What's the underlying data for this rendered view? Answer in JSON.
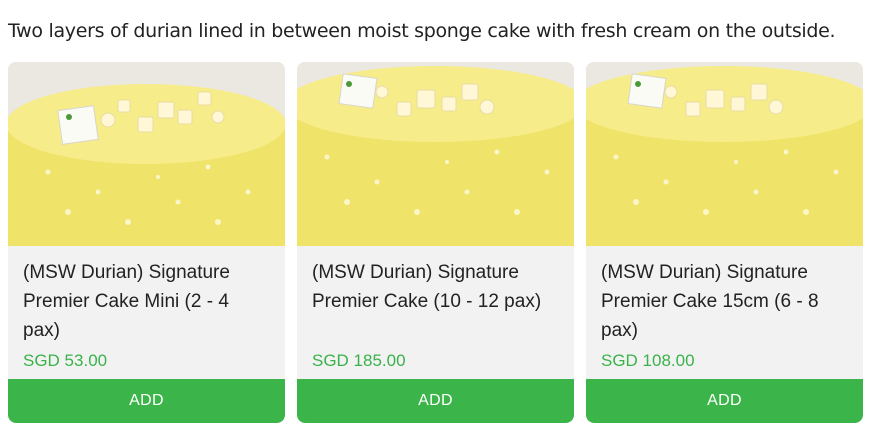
{
  "description": "Two layers of durian lined in between moist sponge cake with fresh cream on the outside.",
  "products": [
    {
      "title": "(MSW Durian) Signature Premier Cake Mini (2 - 4 pax)",
      "price": "SGD 53.00",
      "add_label": "ADD",
      "image_tag_text": "Durian Empire"
    },
    {
      "title": "(MSW Durian) Signature Premier Cake (10 - 12 pax)",
      "price": "SGD 185.00",
      "add_label": "ADD",
      "image_tag_text": "Durian Empire"
    },
    {
      "title": "(MSW Durian) Signature Premier Cake 15cm (6 - 8 pax)",
      "price": "SGD 108.00",
      "add_label": "ADD",
      "image_tag_text": "Durian Empire"
    }
  ],
  "colors": {
    "accent_green": "#3bb54a",
    "price_green": "#3ab24a",
    "card_bg": "#f2f2f3",
    "cake_yellow": "#f2e46a"
  }
}
